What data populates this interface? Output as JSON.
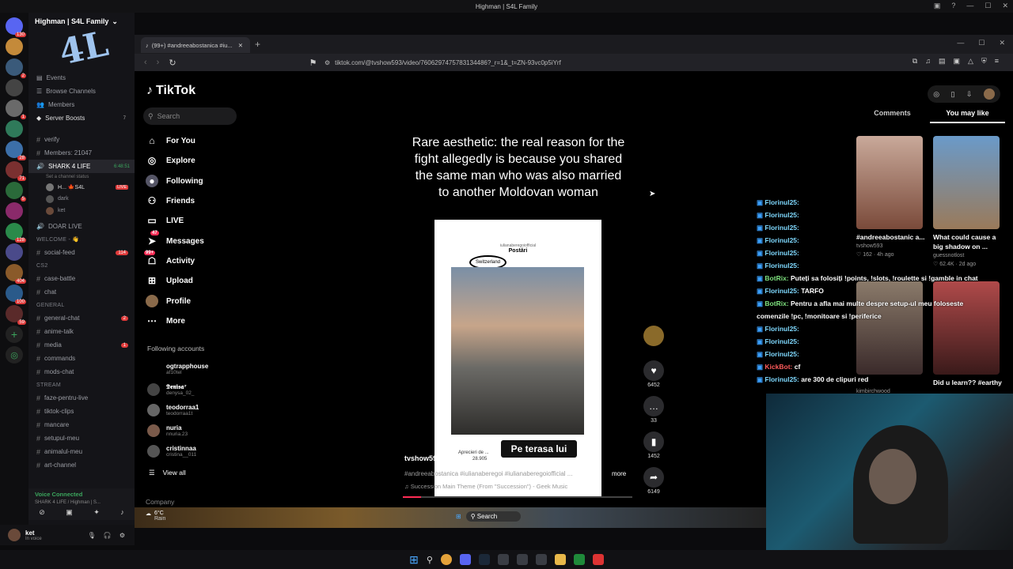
{
  "window": {
    "title": "Highman | S4L Family"
  },
  "discord": {
    "server_name": "Highman | S4L Family",
    "top_items": [
      "Events",
      "Browse Channels",
      "Members",
      "Server Boosts"
    ],
    "server_boosts_count": "7",
    "channels_a": [
      {
        "name": "verify"
      },
      {
        "name": "Members: 21047"
      },
      {
        "name": "SHARK 4 LIFE",
        "note": "6:48:51",
        "status": "Set a channel status"
      }
    ],
    "voice_users": [
      {
        "name": "H... 🍁S4L",
        "badge": "LIVE"
      },
      {
        "name": "dark"
      },
      {
        "name": "ket"
      }
    ],
    "doar_live": "DOAR LIVE",
    "cat_welcome": "WELCOME - 👋",
    "social_feed": {
      "name": "social-feed",
      "count": "114"
    },
    "cat_cs2": "CS2",
    "cs2_channels": [
      "case-battle",
      "chat"
    ],
    "cat_general": "GENERAL",
    "general_channels": [
      {
        "name": "general-chat",
        "count": "2"
      },
      {
        "name": "anime-talk",
        "count": ""
      },
      {
        "name": "media",
        "count": "1"
      },
      {
        "name": "commands",
        "count": ""
      },
      {
        "name": "mods-chat",
        "count": ""
      }
    ],
    "cat_stream": "STREAM",
    "stream_channels": [
      "faze-pentru-live",
      "tiktok-clips",
      "mancare",
      "setupul-meu",
      "animalul-meu",
      "art-channel"
    ],
    "voice_connected": "Voice Connected",
    "voice_channel": "SHARK 4 LIFE / Highman | S...",
    "user_name": "ket",
    "user_status": "In voice",
    "rail_badges": [
      "130",
      "2",
      "1",
      "28",
      "71",
      "5",
      "128",
      "404",
      "100",
      "59"
    ]
  },
  "browser": {
    "tab_title": "(99+) #andreeabostanica #iu...",
    "url": "tiktok.com/@tvshow593/video/7606297475783134486?_r=1&_t=ZN-93vc0p5iYrf"
  },
  "tiktok": {
    "logo": "TikTok",
    "search_placeholder": "Search",
    "nav": [
      "For You",
      "Explore",
      "Following",
      "Friends",
      "LIVE",
      "Messages",
      "Activity",
      "Upload",
      "Profile",
      "More"
    ],
    "messages_badge": "47",
    "activity_badge": "99+",
    "following_accounts_title": "Following accounts",
    "accounts": [
      {
        "name": "ogtrapphouse",
        "handle": "af10tel"
      },
      {
        "name": "𝕯𝖊𝖓𝖎𝖘𝖆⁷",
        "handle": "denysa_02_"
      },
      {
        "name": "teodorraa1",
        "handle": "teodorraa1t"
      },
      {
        "name": "nuria",
        "handle": "nnuria.23"
      },
      {
        "name": "cristinnaa",
        "handle": "cristina__011"
      }
    ],
    "view_all": "View all",
    "company": "Company",
    "caption": "Rare aesthetic: the real reason for the fight allegedly is because you shared the same man who was also married to another Moldovan woman",
    "phone_user": "iulianaberegoiofficial",
    "phone_header": "Postări",
    "phone_tag": "Switzerland",
    "phone_likes": "Aprecieri de ...",
    "phone_count": "28.905",
    "pill_text": "Pe terasa lui",
    "author": "tvshow593",
    "tags": "#andreeabostanica #iulianaberegoi #iulianaberegoiofficial ...",
    "more": "more",
    "music": "Succession Main Theme (From \"Succession\") - Geek Music",
    "likes": "6452",
    "comments": "33",
    "saves": "1452",
    "shares": "6149",
    "right_tabs": [
      "Comments",
      "You may like"
    ],
    "suggestions": [
      {
        "title": "#andreeabostanic a...",
        "author": "tvshow593",
        "likes": "162",
        "age": "4h ago"
      },
      {
        "title": "What could cause a big shadow on ...",
        "author": "guessnotlost",
        "likes": "62.4K",
        "age": "2d ago"
      },
      {
        "title": "",
        "author": "kimbirchwood",
        "likes": "",
        "age": ""
      },
      {
        "title": "Did u learn?? #earthy",
        "author": "",
        "likes": "",
        "age": ""
      }
    ]
  },
  "chat": [
    {
      "user": "Florinul25:",
      "msg": "",
      "type": "u"
    },
    {
      "user": "Florinul25:",
      "msg": "",
      "type": "u"
    },
    {
      "user": "Florinul25:",
      "msg": "",
      "type": "u"
    },
    {
      "user": "Florinul25:",
      "msg": "",
      "type": "u"
    },
    {
      "user": "Florinul25:",
      "msg": "",
      "type": "u"
    },
    {
      "user": "Florinul25:",
      "msg": "",
      "type": "u"
    },
    {
      "user": "BotRix:",
      "msg": "Puteți sa folosiți !points, !slots, !roulette si !gamble in chat",
      "type": "bot"
    },
    {
      "user": "Florinul25:",
      "msg": "TARFO",
      "type": "u"
    },
    {
      "user": "BotRix:",
      "msg": "Pentru a afla mai multe despre setup-ul meu foloseste comenzile !pc, !monitoare si !periferice",
      "type": "bot"
    },
    {
      "user": "Florinul25:",
      "msg": "",
      "type": "u"
    },
    {
      "user": "Florinul25:",
      "msg": "",
      "type": "u"
    },
    {
      "user": "Florinul25:",
      "msg": "",
      "type": "u"
    },
    {
      "user": "KickBot:",
      "msg": "cf",
      "type": "kick"
    },
    {
      "user": "Florinul25:",
      "msg": "are 300 de clipuri red",
      "type": "u"
    }
  ],
  "taskbar_inner": {
    "temp": "6°C",
    "weather": "Rain",
    "search": "Search"
  },
  "colors": {
    "tiktok_red": "#fe2c55",
    "live": "#e03b3b",
    "chat_user": "#7fd9ff"
  }
}
